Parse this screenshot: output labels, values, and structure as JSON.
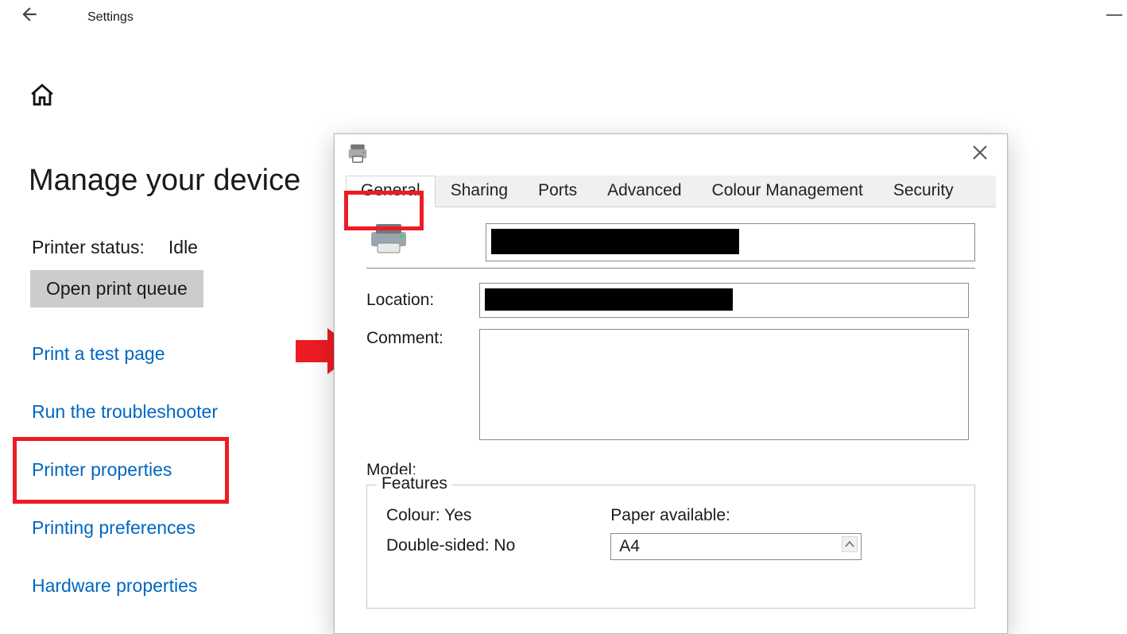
{
  "header": {
    "title": "Settings"
  },
  "page": {
    "heading": "Manage your device",
    "status_label": "Printer status:",
    "status_value": "Idle",
    "open_queue": "Open print queue",
    "links": {
      "test_page": "Print a test page",
      "troubleshoot": "Run the troubleshooter",
      "properties": "Printer properties",
      "preferences": "Printing preferences",
      "hardware": "Hardware properties"
    }
  },
  "dialog": {
    "tabs": {
      "general": "General",
      "sharing": "Sharing",
      "ports": "Ports",
      "advanced": "Advanced",
      "colour": "Colour Management",
      "security": "Security"
    },
    "location_label": "Location:",
    "comment_label": "Comment:",
    "model_label": "Model:",
    "features": {
      "legend": "Features",
      "colour": "Colour: Yes",
      "duplex": "Double-sided: No",
      "paper_available_label": "Paper available:",
      "paper_selected": "A4"
    }
  }
}
